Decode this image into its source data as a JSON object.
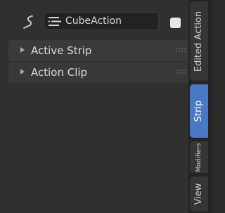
{
  "header": {
    "action_name": "CubeAction",
    "nla_icon": "nla-strip-icon",
    "action_icon": "action-icon",
    "fake_user_icon": "fake-user-toggle"
  },
  "panels": [
    {
      "label": "Active Strip",
      "expanded": false
    },
    {
      "label": "Action Clip",
      "expanded": false
    }
  ],
  "tabs": [
    {
      "label": "Edited Action",
      "active": false
    },
    {
      "label": "Strip",
      "active": true
    },
    {
      "label": "Modifiers",
      "active": false
    },
    {
      "label": "View",
      "active": false
    }
  ],
  "colors": {
    "accent": "#4a78c4",
    "panel_bg": "#303030",
    "text": "#dcdcdc"
  }
}
